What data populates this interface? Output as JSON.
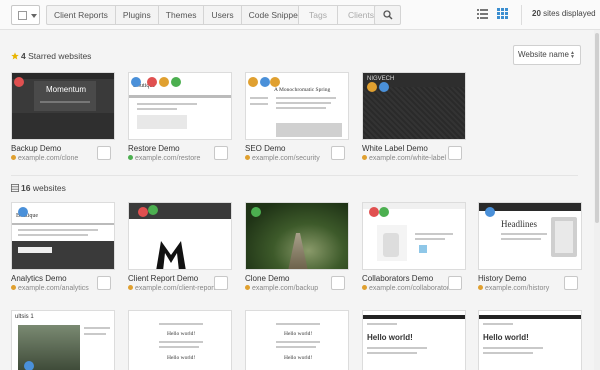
{
  "toolbar": {
    "tabs": [
      "Client Reports",
      "Plugins",
      "Themes",
      "Users",
      "Code Snippets"
    ],
    "muted_tabs": [
      "Tags",
      "Clients"
    ],
    "sites_count": "20",
    "sites_suffix": "sites displayed"
  },
  "starred": {
    "count": "4",
    "label": "Starred websites",
    "sort_value": "Website name",
    "sites": [
      {
        "name": "Backup Demo",
        "url": "example.com/clone",
        "status_color": "#e0a030",
        "badges": [
          "#e05050"
        ]
      },
      {
        "name": "Restore Demo",
        "url": "example.com/restore",
        "status_color": "#4caf50",
        "badges": [
          "#4a90d9",
          "#e05050",
          "#e0a030",
          "#4caf50"
        ]
      },
      {
        "name": "SEO Demo",
        "url": "example.com/security",
        "status_color": "#e0a030",
        "badges": [
          "#e0a030",
          "#4a90d9",
          "#e0a030"
        ]
      },
      {
        "name": "White Label Demo",
        "url": "example.com/white-label",
        "status_color": "#e0a030",
        "badges": [
          "#e0a030",
          "#4a90d9"
        ]
      }
    ]
  },
  "all": {
    "count": "16",
    "label": "websites",
    "sites": [
      {
        "name": "Analytics Demo",
        "url": "example.com/analytics",
        "status_color": "#e0a030",
        "badges": [
          "#4a90d9"
        ]
      },
      {
        "name": "Client Report Demo",
        "url": "example.com/client-report",
        "status_color": "#e0a030",
        "badges": [
          "#e05050",
          "#4caf50"
        ]
      },
      {
        "name": "Clone Demo",
        "url": "example.com/backup",
        "status_color": "#e0a030",
        "badges": [
          "#4caf50"
        ]
      },
      {
        "name": "Collaborators Demo",
        "url": "example.com/collaborators",
        "status_color": "#e0a030",
        "badges": [
          "#e05050",
          "#4caf50"
        ]
      },
      {
        "name": "History Demo",
        "url": "example.com/history",
        "status_color": "#e0a030",
        "badges": [
          "#4a90d9"
        ]
      }
    ]
  },
  "thumb_text": {
    "momentum": "Momentum",
    "alternative": "A Monochromatic Spring",
    "hello": "Hello world!",
    "hello_small": "Hello world!",
    "results": "ultsis 1",
    "boutique": "Boutique",
    "headlines": "Headlines",
    "brand": "NIGVECH"
  }
}
